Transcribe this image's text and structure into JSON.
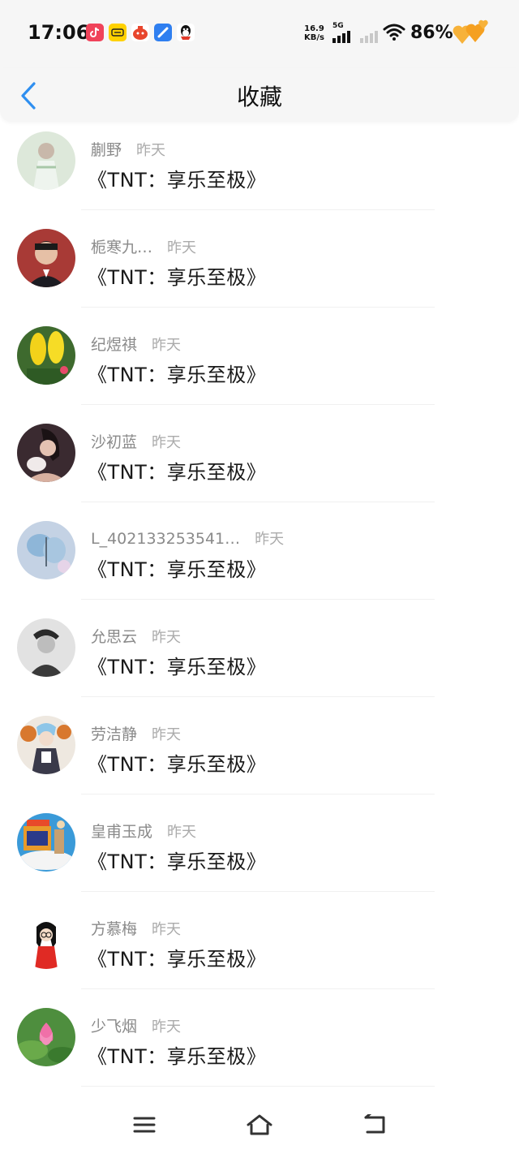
{
  "status_bar": {
    "time": "17:06",
    "net_speed_value": "16.9",
    "net_speed_unit": "KB/s",
    "network_type": "5G",
    "battery": "86%",
    "notification_icons": [
      "douyin-icon",
      "meituan-icon",
      "taobao-icon",
      "chat-icon",
      "qq-icon"
    ]
  },
  "header": {
    "title": "收藏",
    "accent_color": "#2f8ff0"
  },
  "favorites": [
    {
      "user": "蒯野",
      "time": "昨天",
      "title": "《TNT：享乐至极》",
      "avatar_color": "#d8e6d6"
    },
    {
      "user": "栀寒九…",
      "time": "昨天",
      "title": "《TNT：享乐至极》",
      "avatar_color": "#9a3a36"
    },
    {
      "user": "纪煜祺",
      "time": "昨天",
      "title": "《TNT：享乐至极》",
      "avatar_color": "#3e6e2e"
    },
    {
      "user": "沙初蓝",
      "time": "昨天",
      "title": "《TNT：享乐至极》",
      "avatar_color": "#4a3a3e"
    },
    {
      "user": "L_402133253541…",
      "time": "昨天",
      "title": "《TNT：享乐至极》",
      "avatar_color": "#b8c8de"
    },
    {
      "user": "允思云",
      "time": "昨天",
      "title": "《TNT：享乐至极》",
      "avatar_color": "#d4d4d4"
    },
    {
      "user": "劳洁静",
      "time": "昨天",
      "title": "《TNT：享乐至极》",
      "avatar_color": "#e8e2da"
    },
    {
      "user": "皇甫玉成",
      "time": "昨天",
      "title": "《TNT：享乐至极》",
      "avatar_color": "#2f8fd0"
    },
    {
      "user": "方慕梅",
      "time": "昨天",
      "title": "《TNT：享乐至极》",
      "avatar_color": "#ffffff"
    },
    {
      "user": "少飞烟",
      "time": "昨天",
      "title": "《TNT：享乐至极》",
      "avatar_color": "#4a8a3e"
    }
  ],
  "nav_bar": {
    "buttons": [
      "menu-icon",
      "home-icon",
      "back-icon"
    ]
  }
}
